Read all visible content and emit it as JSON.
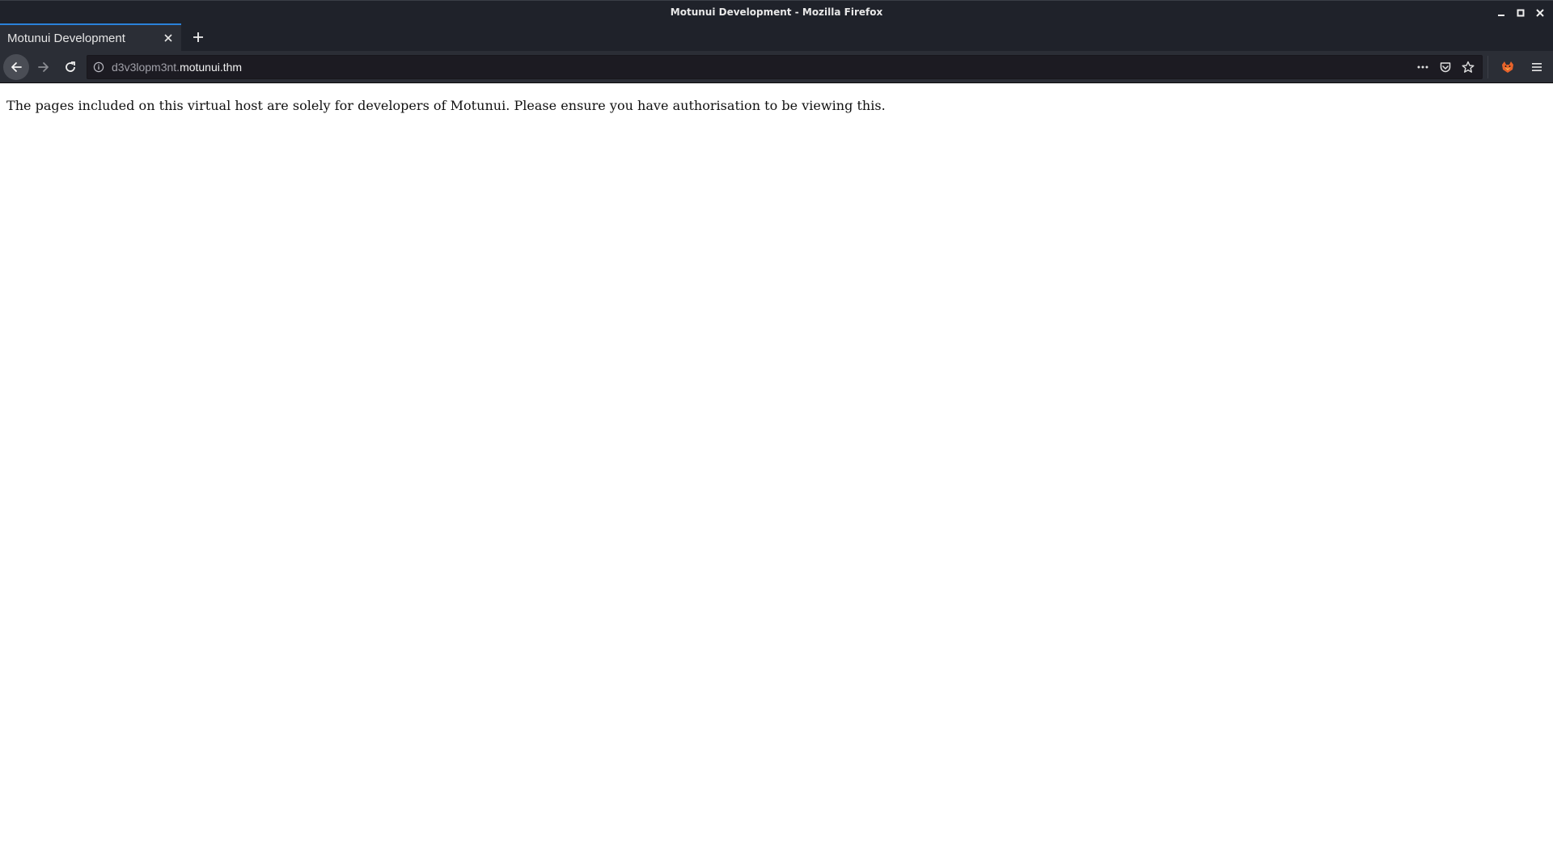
{
  "window": {
    "title": "Motunui Development - Mozilla Firefox"
  },
  "tabs": [
    {
      "label": "Motunui Development",
      "active": true
    }
  ],
  "navbar": {
    "url_subdomain": "d3v3lopm3nt.",
    "url_host": "motunui.thm"
  },
  "page": {
    "text": "The pages included on this virtual host are solely for developers of Motunui. Please ensure you have authorisation to be viewing this."
  },
  "colors": {
    "chrome_bg": "#1f222a",
    "toolbar_bg": "#2b2e36",
    "tab_accent": "#2a82da"
  },
  "icons": {
    "back": "arrow-left-icon",
    "forward": "arrow-right-icon",
    "reload": "reload-icon",
    "info": "info-icon",
    "page_actions": "more-horizontal-icon",
    "pocket": "pocket-icon",
    "bookmark": "star-icon",
    "extension": "fox-extension-icon",
    "menu": "hamburger-menu-icon"
  }
}
